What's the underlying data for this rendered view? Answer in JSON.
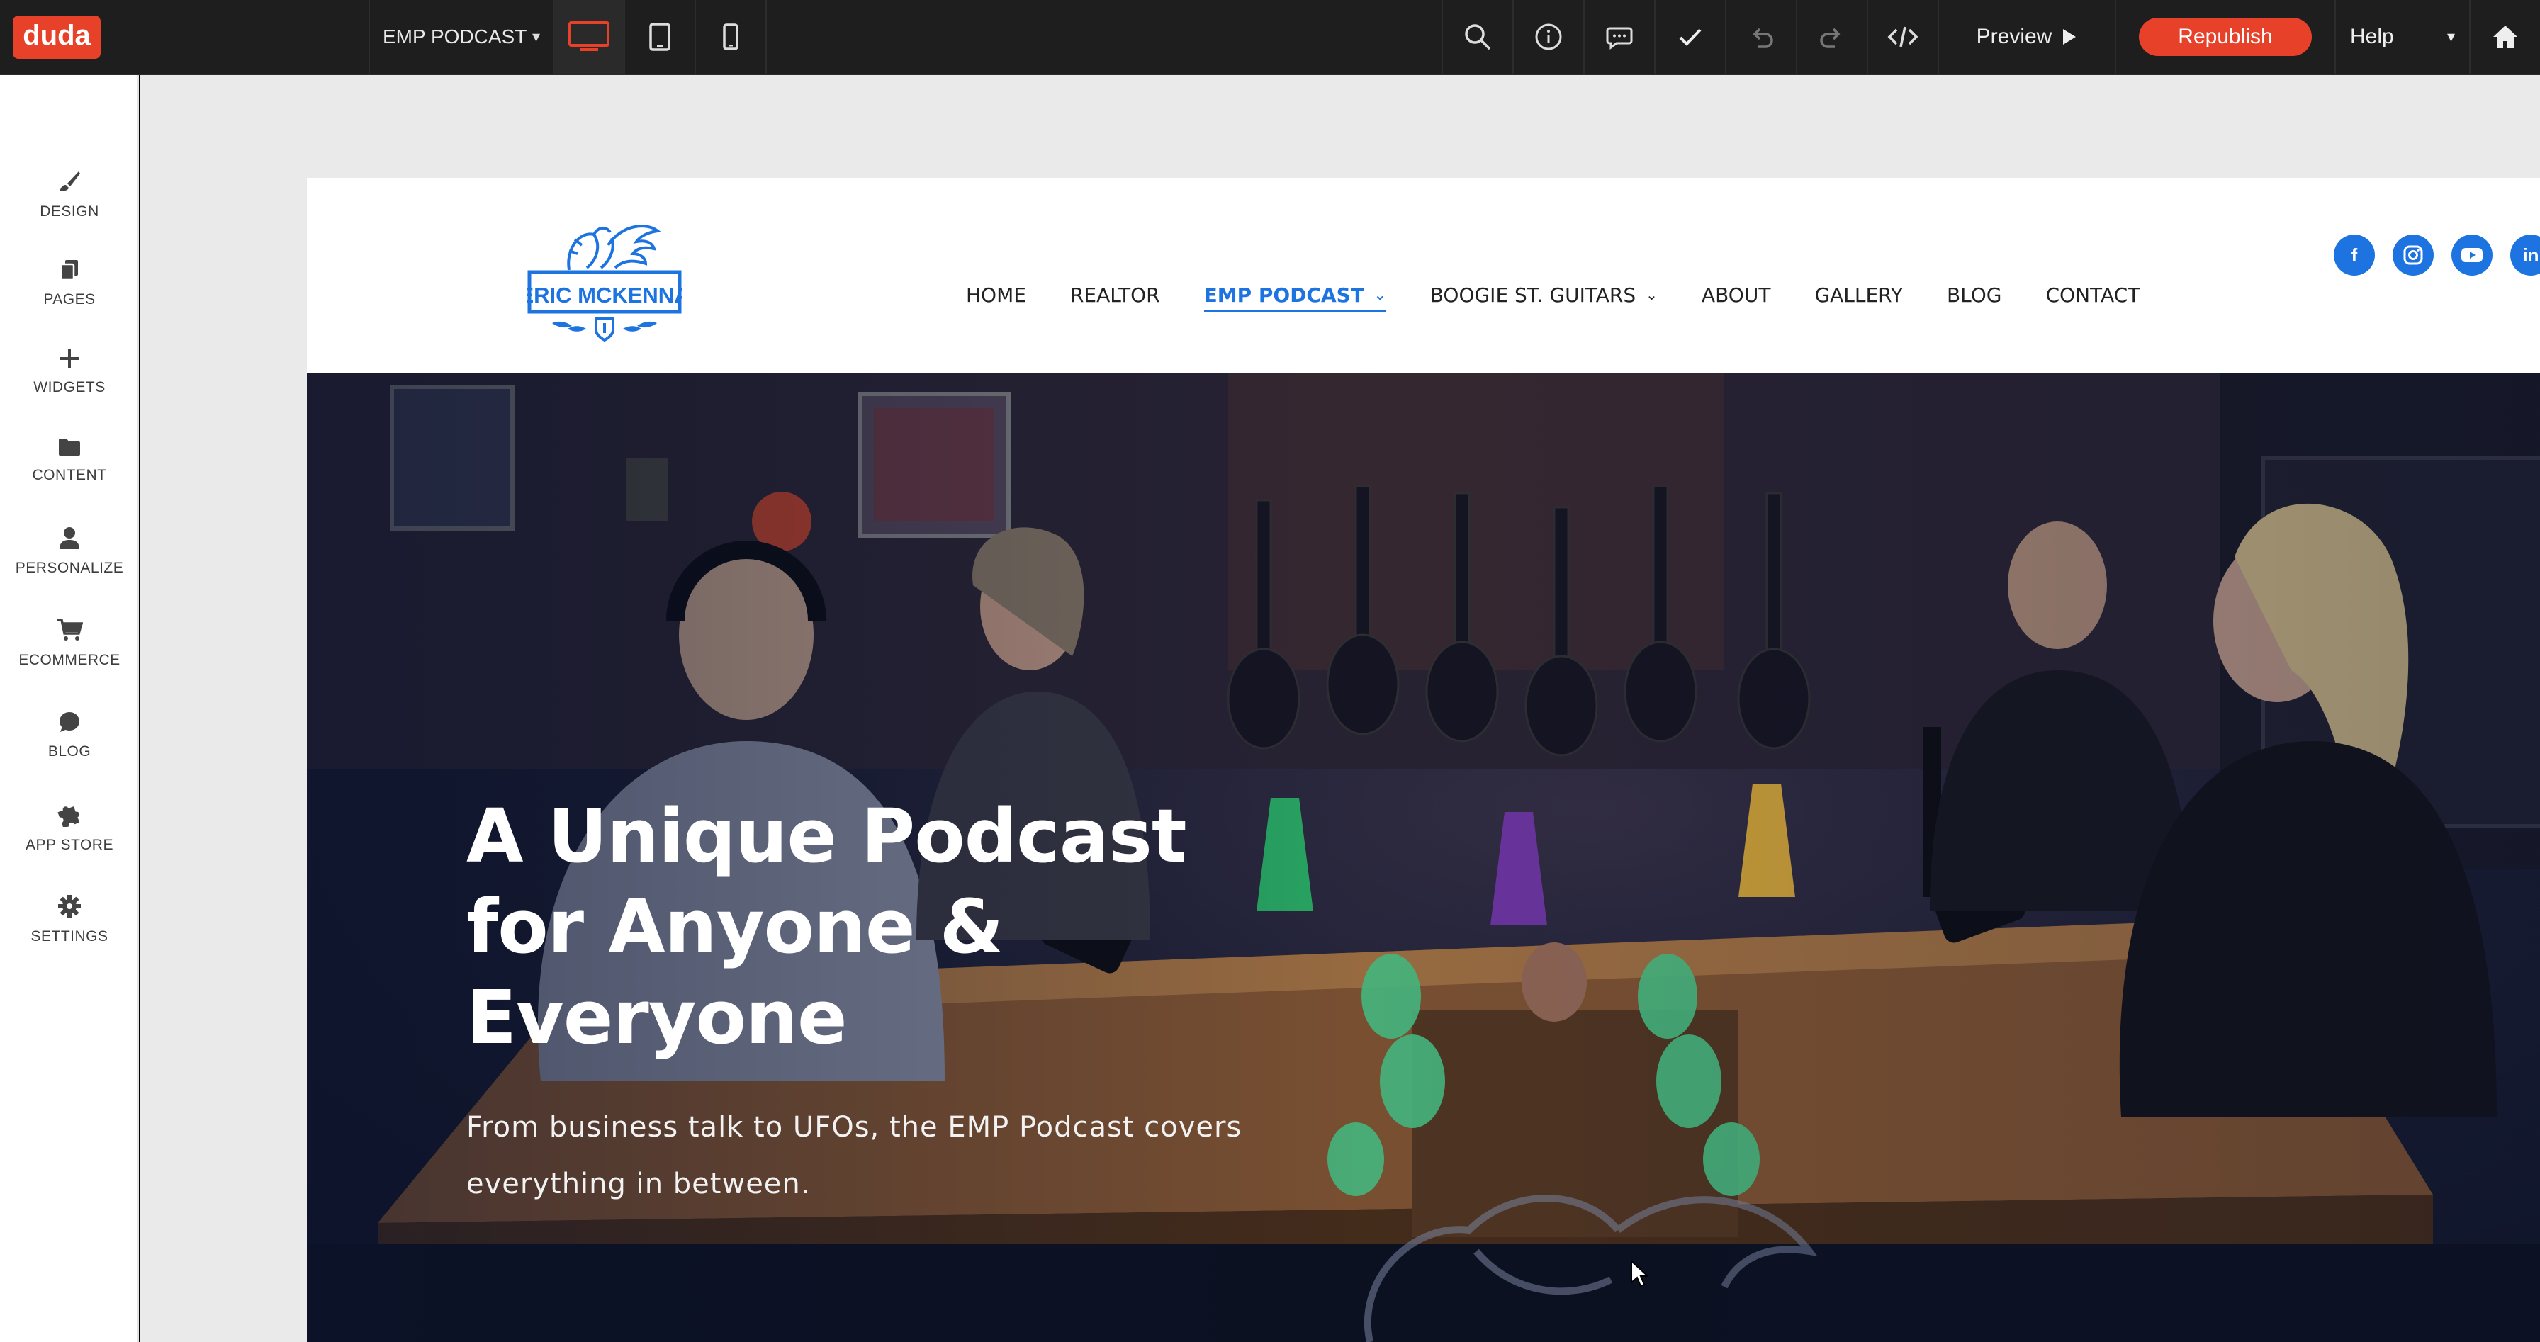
{
  "editor": {
    "brand": "duda",
    "page_selector": "EMP PODCAST",
    "preview_label": "Preview",
    "republish_label": "Republish",
    "help_label": "Help"
  },
  "sidebar": {
    "items": [
      {
        "label": "DESIGN",
        "icon": "brush-icon"
      },
      {
        "label": "PAGES",
        "icon": "pages-icon"
      },
      {
        "label": "WIDGETS",
        "icon": "plus-icon"
      },
      {
        "label": "CONTENT",
        "icon": "folder-icon"
      },
      {
        "label": "PERSONALIZE",
        "icon": "person-icon"
      },
      {
        "label": "ECOMMERCE",
        "icon": "cart-icon"
      },
      {
        "label": "BLOG",
        "icon": "chat-bubble-icon"
      },
      {
        "label": "APP STORE",
        "icon": "puzzle-icon"
      },
      {
        "label": "SETTINGS",
        "icon": "gear-icon"
      }
    ]
  },
  "site": {
    "logo_text": "ERIC MCKENNA",
    "nav": [
      {
        "label": "HOME"
      },
      {
        "label": "REALTOR"
      },
      {
        "label": "EMP PODCAST",
        "active": true,
        "dropdown": true
      },
      {
        "label": "BOOGIE ST. GUITARS",
        "dropdown": true
      },
      {
        "label": "ABOUT"
      },
      {
        "label": "GALLERY"
      },
      {
        "label": "BLOG"
      },
      {
        "label": "CONTACT"
      }
    ],
    "socials": [
      {
        "name": "facebook-icon",
        "glyph": "f"
      },
      {
        "name": "instagram-icon",
        "glyph": ""
      },
      {
        "name": "youtube-icon",
        "glyph": ""
      },
      {
        "name": "linkedin-icon",
        "glyph": "in"
      }
    ],
    "accent_color": "#1d74e0",
    "hero": {
      "title_line1": "A Unique Podcast",
      "title_line2": "for Anyone &",
      "title_line3": "Everyone",
      "subtitle_line1": "From business talk to UFOs, the EMP Podcast covers",
      "subtitle_line2": "everything in between."
    }
  }
}
